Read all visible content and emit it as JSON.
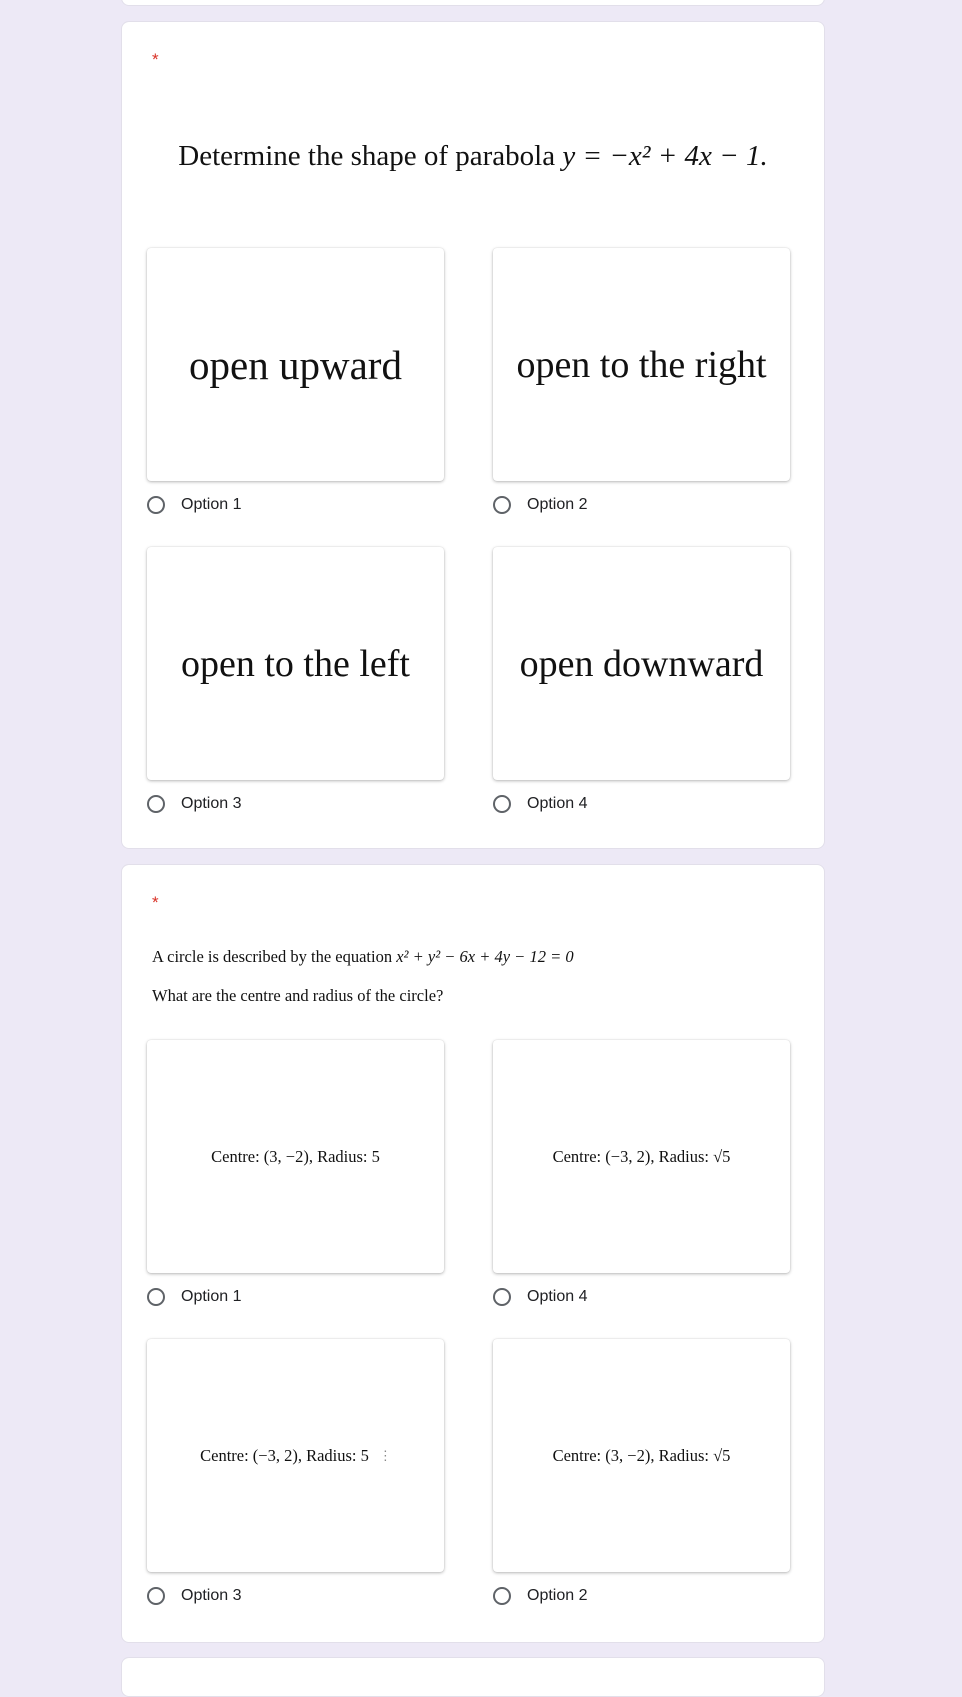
{
  "colors": {
    "background": "#ede9f6",
    "card": "#ffffff",
    "required_asterisk": "#d93025",
    "radio_border": "#5f6368"
  },
  "questions": [
    {
      "required_marker": "*",
      "title_prefix": "Determine the shape of parabola ",
      "title_equation": "y = −x² + 4x − 1.",
      "options": [
        {
          "image_text": "open upward",
          "label": "Option 1"
        },
        {
          "image_text": "open to the right",
          "label": "Option 2"
        },
        {
          "image_text": "open to the left",
          "label": "Option 3"
        },
        {
          "image_text": "open downward",
          "label": "Option 4"
        }
      ]
    },
    {
      "required_marker": "*",
      "line1_prefix": "A circle is described by the equation ",
      "line1_equation": "x² + y² − 6x + 4y − 12 = 0",
      "line2": "What are the centre and radius of the circle?",
      "options": [
        {
          "image_text": "Centre: (3, −2), Radius: 5",
          "label": "Option 1"
        },
        {
          "image_text": "Centre: (−3, 2), Radius: √5",
          "label": "Option 4"
        },
        {
          "image_text": "Centre: (−3, 2), Radius: 5",
          "label": "Option 3"
        },
        {
          "image_text": "Centre: (3, −2), Radius: √5",
          "label": "Option 2"
        }
      ]
    }
  ]
}
